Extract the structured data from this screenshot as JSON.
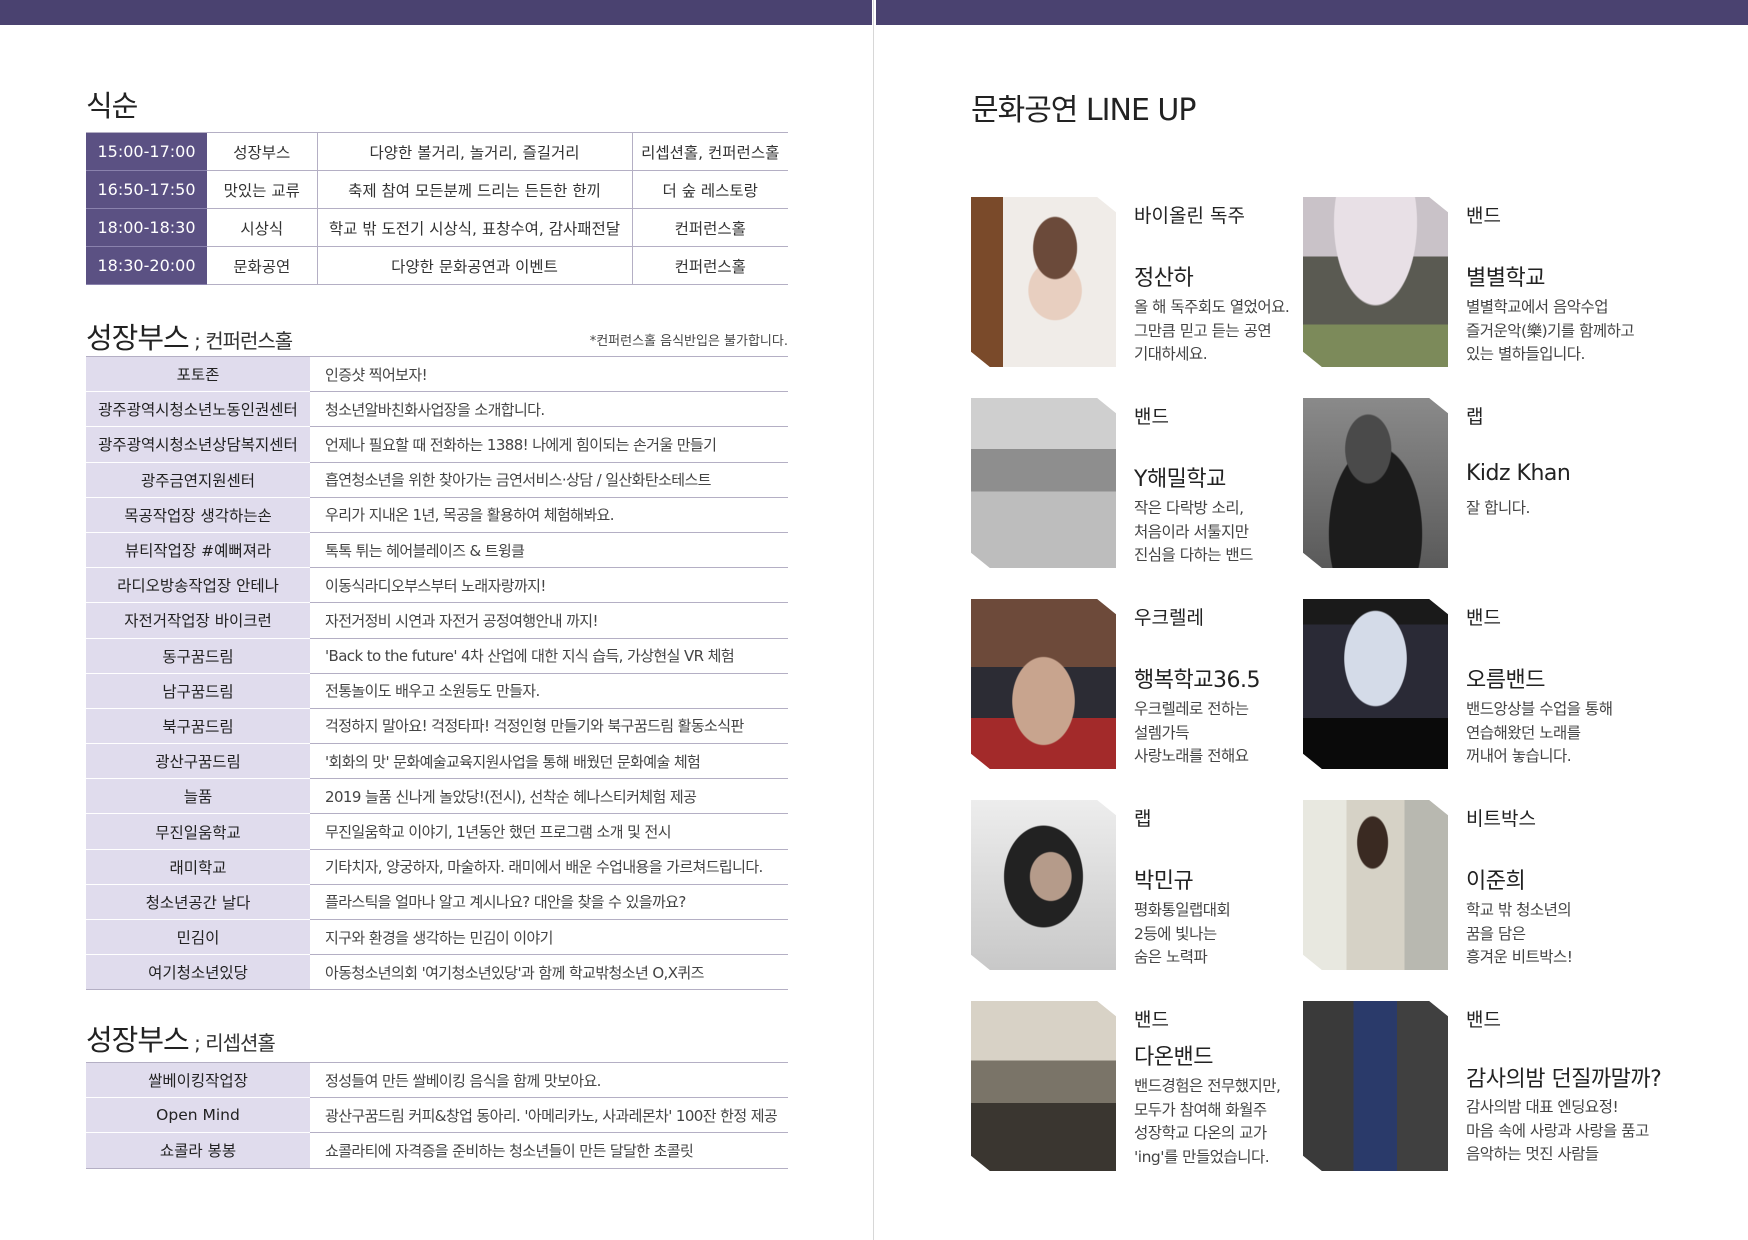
{
  "left": {
    "schedule_title": "식순",
    "schedule": [
      {
        "time": "15:00-17:00",
        "name": "성장부스",
        "desc": "다양한 볼거리, 놀거리, 즐길거리",
        "place": "리셉션홀, 컨퍼런스홀"
      },
      {
        "time": "16:50-17:50",
        "name": "맛있는 교류",
        "desc": "축제 참여 모든분께 드리는 든든한 한끼",
        "place": "더 숲 레스토랑"
      },
      {
        "time": "18:00-18:30",
        "name": "시상식",
        "desc": "학교 밖 도전기 시상식, 표창수여, 감사패전달",
        "place": "컨퍼런스홀"
      },
      {
        "time": "18:30-20:00",
        "name": "문화공연",
        "desc": "다양한 문화공연과 이벤트",
        "place": "컨퍼런스홀"
      }
    ],
    "booth1_title": "성장부스",
    "booth1_sub": " ; 컨퍼런스홀",
    "booth1_note": "*컨퍼런스홀 음식반입은 불가합니다.",
    "booth1": [
      {
        "name": "포토존",
        "desc": "인증샷 찍어보자!"
      },
      {
        "name": "광주광역시청소년노동인권센터",
        "desc": "청소년알바친화사업장을 소개합니다."
      },
      {
        "name": "광주광역시청소년상담복지센터",
        "desc": "언제나 필요할 때 전화하는 1388! 나에게 힘이되는 손거울 만들기"
      },
      {
        "name": "광주금연지원센터",
        "desc": "흡연청소년을 위한 찾아가는 금연서비스·상담 / 일산화탄소테스트"
      },
      {
        "name": "목공작업장 생각하는손",
        "desc": "우리가 지내온 1년, 목공을 활용하여 체험해봐요."
      },
      {
        "name": "뷰티작업장 #예뻐져라",
        "desc": "톡톡 튀는 헤어블레이즈 & 트윙클"
      },
      {
        "name": "라디오방송작업장 안테나",
        "desc": "이동식라디오부스부터 노래자랑까지!"
      },
      {
        "name": "자전거작업장 바이크런",
        "desc": "자전거정비 시연과 자전거 공정여행안내 까지!"
      },
      {
        "name": "동구꿈드림",
        "desc": "'Back to the future' 4차 산업에 대한 지식 습득, 가상현실 VR 체험"
      },
      {
        "name": "남구꿈드림",
        "desc": "전통놀이도 배우고 소원등도 만들자."
      },
      {
        "name": "북구꿈드림",
        "desc": "걱정하지 말아요! 걱정타파! 걱정인형 만들기와 북구꿈드림 활동소식판"
      },
      {
        "name": "광산구꿈드림",
        "desc": "'회화의 맛' 문화예술교육지원사업을 통해 배웠던 문화예술 체험"
      },
      {
        "name": "늘품",
        "desc": "2019 늘품 신나게 놀았당!(전시), 선착순 헤나스티커체험 제공"
      },
      {
        "name": "무진일움학교",
        "desc": "무진일움학교 이야기, 1년동안 했던 프로그램 소개 및 전시"
      },
      {
        "name": "래미학교",
        "desc": "기타치자, 양궁하자, 마술하자. 래미에서 배운 수업내용을 가르쳐드립니다."
      },
      {
        "name": "청소년공간 날다",
        "desc": "플라스틱을 얼마나 알고 계시나요? 대안을 찾을 수 있을까요?"
      },
      {
        "name": "민김이",
        "desc": "지구와 환경을 생각하는 민김이 이야기"
      },
      {
        "name": "여기청소년있당",
        "desc": "아동청소년의회 '여기청소년있당'과 함께 학교밖청소년 O,X퀴즈"
      }
    ],
    "booth2_title": "성장부스",
    "booth2_sub": " ; 리셉션홀",
    "booth2": [
      {
        "name": "쌀베이킹작업장",
        "desc": "정성들여 만든 쌀베이킹 음식을 함께 맛보아요."
      },
      {
        "name": "Open Mind",
        "desc": "광산구꿈드림 커피&창업 동아리. '아메리카노, 사과레몬차' 100잔 한정 제공"
      },
      {
        "name": "쇼콜라 봉봉",
        "desc": "쇼콜라티에 자격증을 준비하는 청소년들이 만든 달달한 초콜릿"
      }
    ]
  },
  "right": {
    "title": "문화공연 LINE UP",
    "cards": [
      {
        "category": "바이올린 독주",
        "name": "정산하",
        "desc": [
          "올 해 독주회도 열었어요.",
          "그만큼 믿고 듣는 공연",
          "기대하세요."
        ]
      },
      {
        "category": "밴드",
        "name": "별별학교",
        "desc": [
          "별별학교에서 음악수업",
          "즐거운악(樂)기를 함께하고",
          "있는 별하들입니다."
        ]
      },
      {
        "category": "밴드",
        "name": "Y해밀학교",
        "desc": [
          "작은 다락방 소리,",
          "처음이라 서툴지만",
          "진심을 다하는 밴드"
        ]
      },
      {
        "category": "랩",
        "name": "Kidz Khan",
        "desc": [
          "잘 합니다."
        ]
      },
      {
        "category": "우크렐레",
        "name": "행복학교36.5",
        "desc": [
          "우크렐레로 전하는",
          "설렘가득",
          "사랑노래를 전해요"
        ]
      },
      {
        "category": "밴드",
        "name": "오름밴드",
        "desc": [
          "밴드앙상블 수업을 통해",
          "연습해왔던 노래를",
          "꺼내어 놓습니다."
        ]
      },
      {
        "category": "랩",
        "name": "박민규",
        "desc": [
          "평화통일랩대회",
          "2등에 빛나는",
          "숨은 노력파"
        ]
      },
      {
        "category": "비트박스",
        "name": "이준희",
        "desc": [
          "학교 밖 청소년의",
          "꿈을 담은",
          "흥겨운 비트박스!"
        ]
      },
      {
        "category": "밴드",
        "name": "다온밴드",
        "desc": [
          "밴드경험은 전무했지만,",
          "모두가 참여해 화월주",
          "성장학교 다온의 교가",
          "'ing'를 만들었습니다."
        ]
      },
      {
        "category": "밴드",
        "name": "감사의밤 던질까말까?",
        "desc": [
          "감사의밤 대표 엔딩요정!",
          "마음 속에 사랑과 사랑을 품고",
          "음악하는 멋진 사람들"
        ]
      }
    ]
  },
  "colors": {
    "accent": "#4a4270",
    "row_header": "#5b5183",
    "booth_name_bg": "#e0dced"
  }
}
